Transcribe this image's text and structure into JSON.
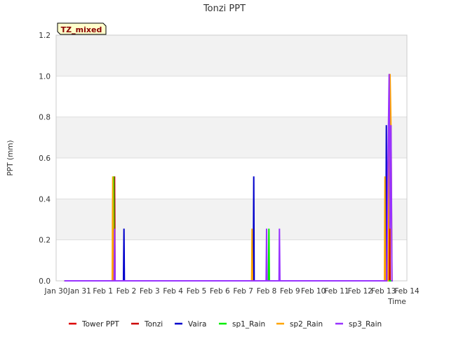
{
  "chart_data": {
    "type": "line",
    "title": "Tonzi PPT",
    "xlabel": "Time",
    "ylabel": "PPT (mm)",
    "annotation": "TZ_mixed",
    "x_ticks": [
      "Jan 30",
      "Jan 31",
      "Feb 1",
      "Feb 2",
      "Feb 3",
      "Feb 4",
      "Feb 5",
      "Feb 6",
      "Feb 7",
      "Feb 8",
      "Feb 9",
      "Feb 10",
      "Feb 11",
      "Feb 12",
      "Feb 13",
      "Feb 14"
    ],
    "y_ticks": [
      "0.0",
      "0.2",
      "0.4",
      "0.6",
      "0.8",
      "1.0",
      "1.2"
    ],
    "xlim": [
      0,
      15
    ],
    "ylim": [
      0,
      1.2
    ],
    "x_unit_note": "x in days after Jan 30",
    "grid": "horizontal bands",
    "legend_position": "bottom",
    "series": [
      {
        "name": "Tower PPT",
        "color": "#dd0000",
        "points": []
      },
      {
        "name": "Tonzi",
        "color": "#cc0000",
        "points": [
          [
            0.35,
            0
          ],
          [
            2.48,
            0
          ],
          [
            2.5,
            0.51
          ],
          [
            2.52,
            0
          ],
          [
            14.22,
            0
          ],
          [
            14.25,
            1.01
          ],
          [
            14.28,
            0
          ],
          [
            14.4,
            0
          ]
        ]
      },
      {
        "name": "Vaira",
        "color": "#0000cc",
        "points": [
          [
            0.35,
            0
          ],
          [
            2.88,
            0
          ],
          [
            2.9,
            0.255
          ],
          [
            2.92,
            0
          ],
          [
            8.43,
            0
          ],
          [
            8.45,
            0.51
          ],
          [
            8.47,
            0
          ],
          [
            14.1,
            0
          ],
          [
            14.12,
            0.76
          ],
          [
            14.14,
            0
          ],
          [
            14.4,
            0
          ]
        ]
      },
      {
        "name": "sp1_Rain",
        "color": "#00ee00",
        "points": [
          [
            0.35,
            0
          ],
          [
            2.44,
            0
          ],
          [
            2.46,
            0.51
          ],
          [
            2.48,
            0
          ],
          [
            9.08,
            0
          ],
          [
            9.1,
            0.255
          ],
          [
            9.12,
            0
          ],
          [
            14.4,
            0
          ]
        ]
      },
      {
        "name": "sp2_Rain",
        "color": "#ffa500",
        "points": [
          [
            0.35,
            0
          ],
          [
            2.4,
            0
          ],
          [
            2.42,
            0.51
          ],
          [
            2.46,
            0
          ],
          [
            8.36,
            0
          ],
          [
            8.38,
            0.255
          ],
          [
            8.4,
            0
          ],
          [
            14.04,
            0
          ],
          [
            14.06,
            0.51
          ],
          [
            14.08,
            0
          ],
          [
            14.2,
            0
          ],
          [
            14.24,
            0.76
          ],
          [
            14.28,
            1.01
          ],
          [
            14.32,
            0.76
          ],
          [
            14.36,
            0
          ],
          [
            14.4,
            0
          ]
        ]
      },
      {
        "name": "sp3_Rain",
        "color": "#9933ff",
        "points": [
          [
            0.35,
            0
          ],
          [
            2.48,
            0
          ],
          [
            2.5,
            0.255
          ],
          [
            2.52,
            0
          ],
          [
            8.98,
            0
          ],
          [
            9.0,
            0.255
          ],
          [
            9.02,
            0
          ],
          [
            9.53,
            0
          ],
          [
            9.55,
            0.255
          ],
          [
            9.57,
            0
          ],
          [
            14.14,
            0
          ],
          [
            14.18,
            0.5
          ],
          [
            14.24,
            1.01
          ],
          [
            14.28,
            0.255
          ],
          [
            14.32,
            0.76
          ],
          [
            14.36,
            0
          ],
          [
            14.4,
            0
          ]
        ]
      }
    ]
  }
}
